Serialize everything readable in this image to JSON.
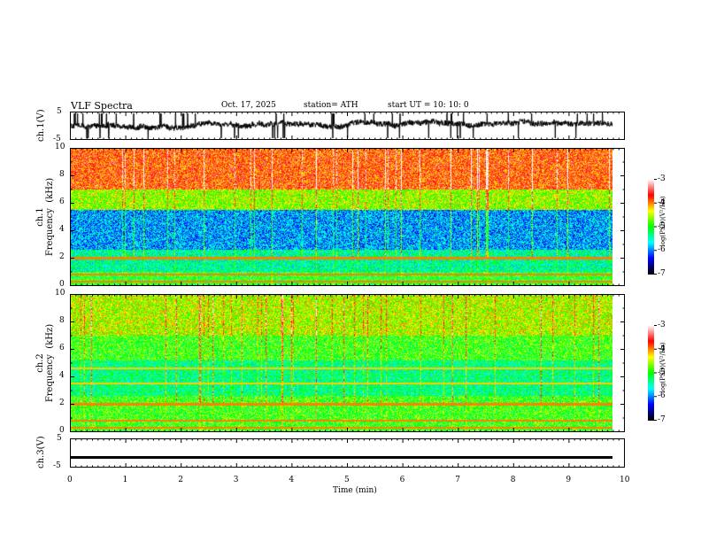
{
  "header": {
    "title": "VLF  Spectra",
    "date": "Oct. 17, 2025",
    "station": "station= ATH",
    "start": "start  UT  =    10: 10: 0"
  },
  "chart_data": [
    {
      "type": "line",
      "panel": "ch.1",
      "ylabel": "ch.1(V)",
      "yticks": [
        "5",
        "-5"
      ],
      "ylim": [
        -5,
        5
      ],
      "xlim": [
        0,
        10
      ]
    },
    {
      "type": "heatmap",
      "panel": "ch.1 spectrogram",
      "ylabel": "ch.1\nFrequency  (kHz)",
      "yticks": [
        "0",
        "2",
        "4",
        "6",
        "8",
        "10"
      ],
      "ylim": [
        0,
        10
      ],
      "xlim": [
        0,
        10
      ],
      "data_end_min": 9.8,
      "colorbar": {
        "label": "log(PSD)(V²/Hz)",
        "ticks": [
          "-3",
          "-4",
          "-5",
          "-6",
          "-7"
        ],
        "range": [
          -7,
          -3
        ],
        "colormap": [
          "#000000",
          "#0000ff",
          "#00ffff",
          "#00ff00",
          "#ffff00",
          "#ff0000",
          "#ffffff"
        ]
      }
    },
    {
      "type": "heatmap",
      "panel": "ch.2 spectrogram",
      "ylabel": "ch.2\nFrequency  (kHz)",
      "yticks": [
        "0",
        "2",
        "4",
        "6",
        "8",
        "10"
      ],
      "ylim": [
        0,
        10
      ],
      "xlim": [
        0,
        10
      ],
      "data_end_min": 9.8,
      "colorbar": {
        "label": "log(PSD)(V²/Hz)",
        "ticks": [
          "-3",
          "-4",
          "-5",
          "-6",
          "-7"
        ],
        "range": [
          -7,
          -3
        ]
      }
    },
    {
      "type": "line",
      "panel": "ch.3",
      "ylabel": "ch.3(V)",
      "yticks": [
        "5",
        "-5"
      ],
      "ylim": [
        -5,
        5
      ],
      "xlim": [
        0,
        10
      ],
      "level": -1.5
    },
    {
      "type": "axis",
      "xlabel": "Time  (min)",
      "xticks": [
        "0",
        "1",
        "2",
        "3",
        "4",
        "5",
        "6",
        "7",
        "8",
        "9",
        "10"
      ]
    }
  ]
}
